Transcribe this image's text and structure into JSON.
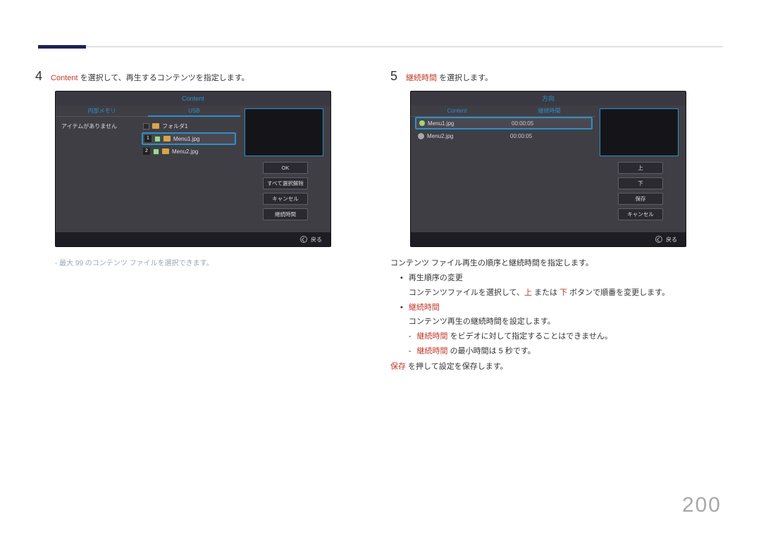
{
  "page_number": "200",
  "left": {
    "step_number": "4",
    "step_text_red": "Content",
    "step_text_rest": " を選択して、再生するコンテンツを指定します。",
    "screenshot": {
      "title": "Content",
      "tabs": {
        "left": "内部メモリ",
        "right": "USB"
      },
      "left_empty": "アイテムがありません",
      "folder_label": "フォルダ1",
      "files": [
        {
          "idx": "1",
          "name": "Menu1.jpg",
          "selected": true
        },
        {
          "idx": "2",
          "name": "Menu2.jpg",
          "selected": false
        }
      ],
      "buttons": [
        "OK",
        "すべて選択解除",
        "キャンセル",
        "継続時間"
      ],
      "back": "戻る"
    },
    "note": "最大 99 のコンテンツ ファイルを選択できます。"
  },
  "right": {
    "step_number": "5",
    "step_text_red": "継続時間",
    "step_text_rest": " を選択します。",
    "screenshot": {
      "title": "方向",
      "headers": {
        "name": "Content",
        "dur": "継続時間"
      },
      "rows": [
        {
          "name": "Menu1.jpg",
          "time": "00:00:05",
          "icon": "dot",
          "selected": true
        },
        {
          "name": "Menu2.jpg",
          "time": "00:00:05",
          "icon": "person",
          "selected": false
        }
      ],
      "buttons": [
        "上",
        "下",
        "保存",
        "キャンセル"
      ],
      "back": "戻る"
    },
    "para_intro": "コンテンツ ファイル再生の順序と継続時間を指定します。",
    "bullet1_title": "再生順序の変更",
    "bullet1_body_a": "コンテンツファイルを選択して、",
    "bullet1_up": "上",
    "bullet1_mid": " または ",
    "bullet1_down": "下",
    "bullet1_body_b": " ボタンで順番を変更します。",
    "bullet2_title": "継続時間",
    "bullet2_body": "コンテンツ再生の継続時間を設定します。",
    "dash1_red": "継続時間",
    "dash1_rest": " をビデオに対して指定することはできません。",
    "dash2_red": "継続時間",
    "dash2_rest": " の最小時間は 5 秒です。",
    "save_red": "保存",
    "save_rest": " を押して設定を保存します。"
  }
}
